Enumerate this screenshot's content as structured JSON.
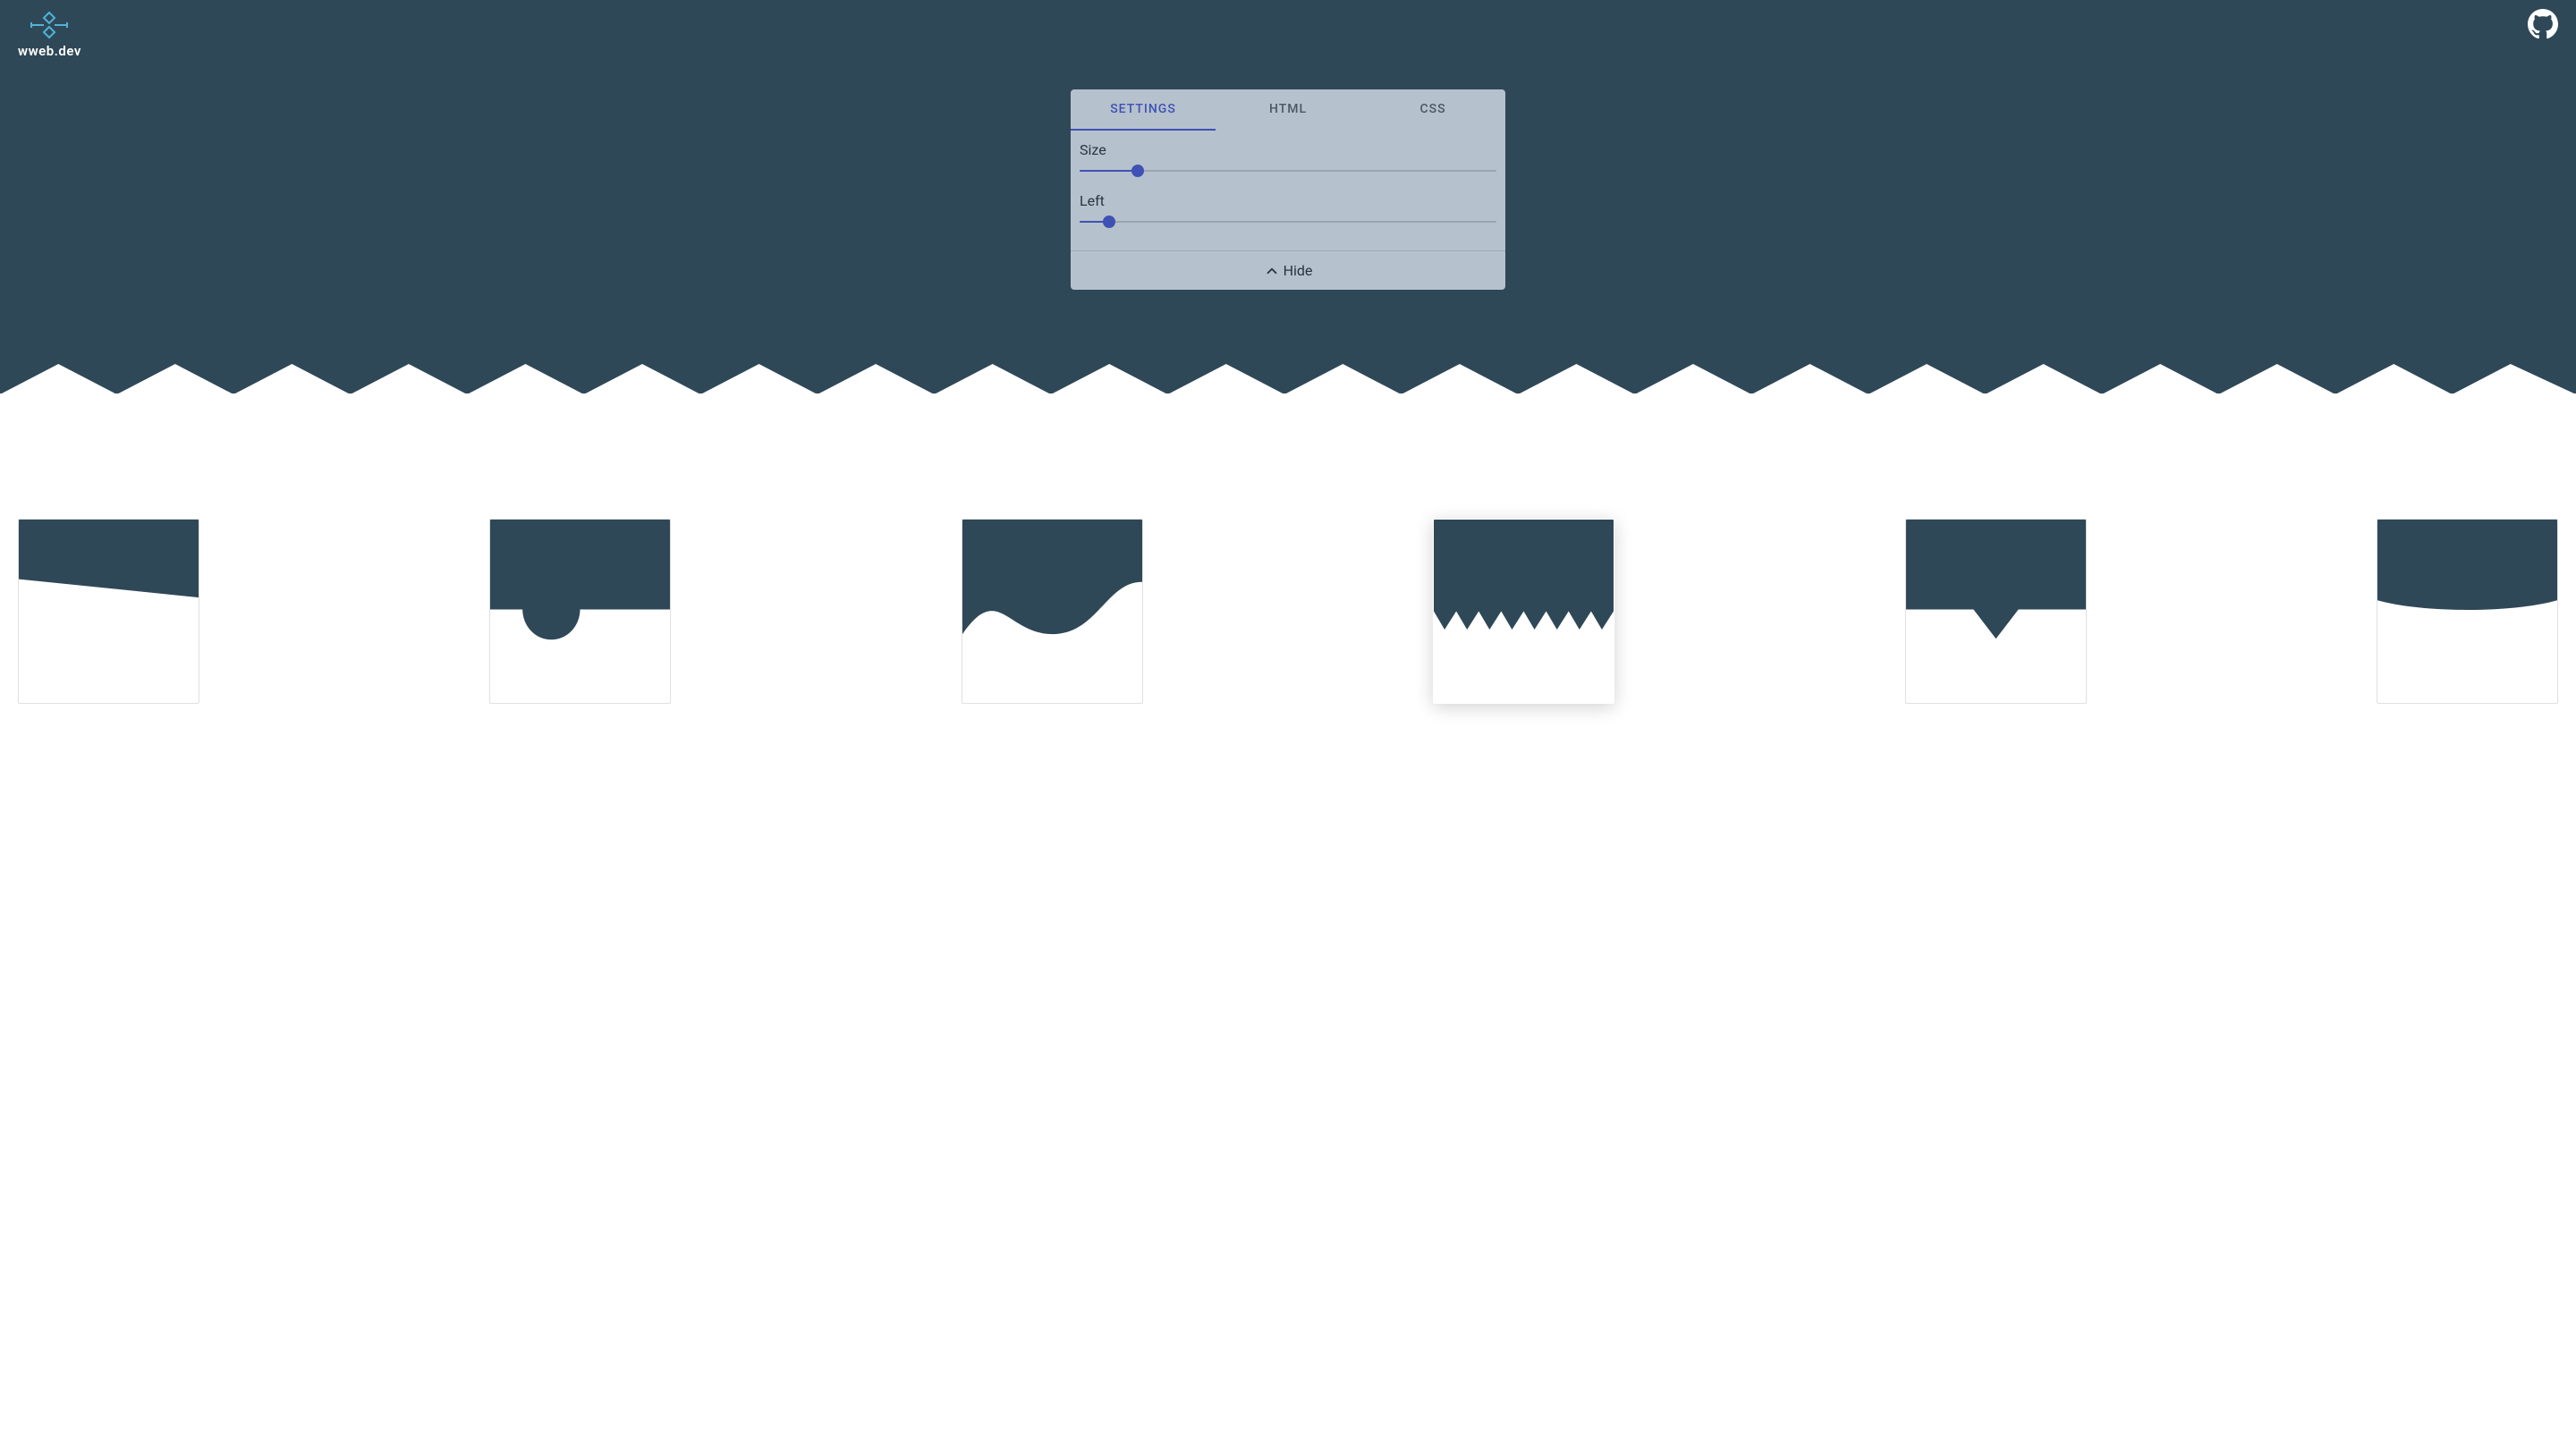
{
  "header": {
    "site_name": "wweb.dev"
  },
  "panel": {
    "tabs": [
      {
        "label": "Settings",
        "active": true
      },
      {
        "label": "HTML",
        "active": false
      },
      {
        "label": "CSS",
        "active": false
      }
    ],
    "sliders": [
      {
        "label": "Size",
        "value": 14
      },
      {
        "label": "Left",
        "value": 7
      }
    ],
    "hide_label": "Hide"
  },
  "colors": {
    "primary": "#2f4858",
    "accent": "#3f51b5"
  },
  "separators": [
    {
      "name": "skew",
      "active": false
    },
    {
      "name": "semicircle",
      "active": false
    },
    {
      "name": "wave",
      "active": false
    },
    {
      "name": "zigzag",
      "active": true
    },
    {
      "name": "triangle",
      "active": false
    },
    {
      "name": "curve",
      "active": false
    }
  ]
}
